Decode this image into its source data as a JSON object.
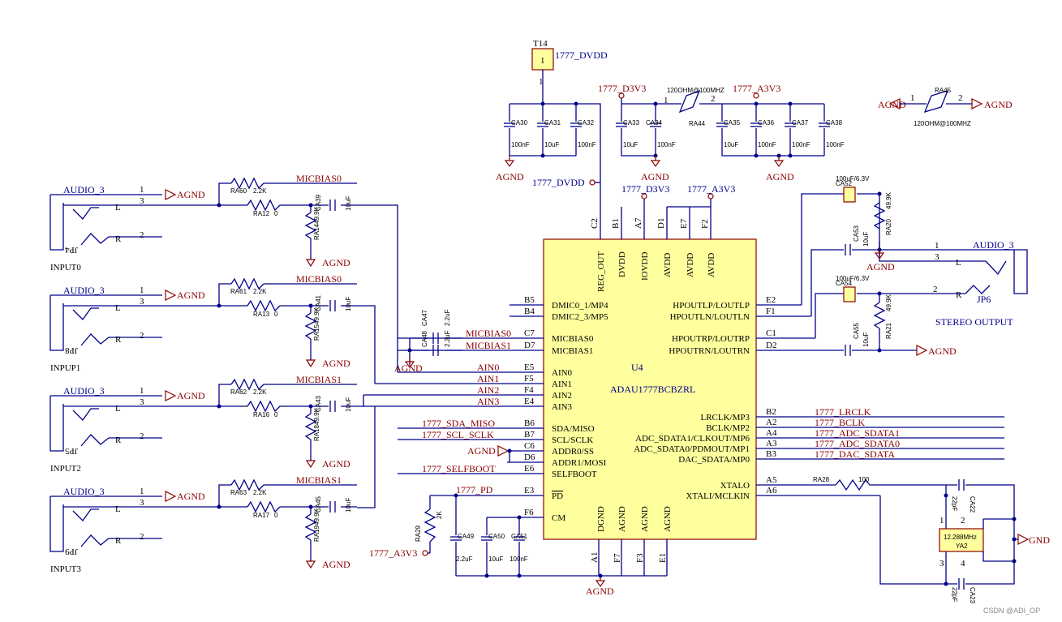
{
  "ic": {
    "ref": "U4",
    "part": "ADAU1777BCBZRL",
    "top_pins": [
      {
        "num": "C2",
        "name": "REG_OUT"
      },
      {
        "num": "B1",
        "name": "DVDD"
      },
      {
        "num": "A7",
        "name": "IOVDD"
      },
      {
        "num": "D1",
        "name": "AVDD"
      },
      {
        "num": "E7",
        "name": "AVDD"
      },
      {
        "num": "F2",
        "name": "AVDD"
      }
    ],
    "left_pins": [
      {
        "num": "B5",
        "name": "DMIC0_1/MP4"
      },
      {
        "num": "B4",
        "name": "DMIC2_3/MP5"
      },
      {
        "num": "C7",
        "name": "MICBIAS0"
      },
      {
        "num": "D7",
        "name": "MICBIAS1"
      },
      {
        "num": "E5",
        "name": "AIN0"
      },
      {
        "num": "F5",
        "name": "AIN1"
      },
      {
        "num": "F4",
        "name": "AIN2"
      },
      {
        "num": "E4",
        "name": "AIN3"
      },
      {
        "num": "B6",
        "name": "SDA/MISO"
      },
      {
        "num": "B7",
        "name": "SCL/SCLK"
      },
      {
        "num": "C6",
        "name": "ADDR0/SS"
      },
      {
        "num": "D6",
        "name": "ADDR1/MOSI"
      },
      {
        "num": "E6",
        "name": "SELFBOOT"
      },
      {
        "num": "E3",
        "name": "PD"
      },
      {
        "num": "F6",
        "name": "CM"
      }
    ],
    "right_pins": [
      {
        "num": "E2",
        "name": "HPOUTLP/LOUTLP"
      },
      {
        "num": "F1",
        "name": "HPOUTLN/LOUTLN"
      },
      {
        "num": "C1",
        "name": "HPOUTRP/LOUTRP"
      },
      {
        "num": "D2",
        "name": "HPOUTRN/LOUTRN"
      },
      {
        "num": "B2",
        "name": "LRCLK/MP3"
      },
      {
        "num": "A2",
        "name": "BCLK/MP2"
      },
      {
        "num": "A4",
        "name": "ADC_SDATA1/CLKOUT/MP6"
      },
      {
        "num": "A3",
        "name": "ADC_SDATA0/PDMOUT/MP1"
      },
      {
        "num": "B3",
        "name": "DAC_SDATA/MP0"
      },
      {
        "num": "A5",
        "name": "XTALO"
      },
      {
        "num": "A6",
        "name": "XTALI/MCLKIN"
      }
    ],
    "bottom_pins": [
      {
        "num": "A1",
        "name": "DGND"
      },
      {
        "num": "F7",
        "name": "AGND"
      },
      {
        "num": "F3",
        "name": "AGND"
      },
      {
        "num": "E1",
        "name": "AGND"
      }
    ]
  },
  "nets": {
    "agnd": "AGND",
    "gnd": "GND",
    "dvdd": "1777_DVDD",
    "d3v3": "1777_D3V3",
    "a3v3": "1777_A3V3",
    "micbias0": "MICBIAS0",
    "micbias1": "MICBIAS1",
    "ain0": "AIN0",
    "ain1": "AIN1",
    "ain2": "AIN2",
    "ain3": "AIN3",
    "sda": "1777_SDA_MISO",
    "scl": "1777_SCL_SCLK",
    "selfboot": "1777_SELFBOOT",
    "pd": "1777_PD",
    "lrclk": "1777_LRCLK",
    "bclk": "1777_BCLK",
    "adc1": "1777_ADC_SDATA1",
    "adc0": "1777_ADC_SDATA0",
    "dac": "1777_DAC_SDATA"
  },
  "inputs": [
    {
      "jack": "AUDIO_3",
      "ref": "JP4",
      "label": "INPUT0",
      "r_bias": "RA60",
      "r_series": "RA12",
      "r_load": "RA14",
      "cap": "CA39"
    },
    {
      "jack": "AUDIO_3",
      "ref": "JP8",
      "label": "INPUP1",
      "r_bias": "RA61",
      "r_series": "RA13",
      "r_load": "RA15",
      "cap": "CA41"
    },
    {
      "jack": "AUDIO_3",
      "ref": "JP5",
      "label": "INPUT2",
      "r_bias": "RA62",
      "r_series": "RA16",
      "r_load": "RA18",
      "cap": "CA43"
    },
    {
      "jack": "AUDIO_3",
      "ref": "JP9",
      "label": "INPUT3",
      "r_bias": "RA63",
      "r_series": "RA17",
      "r_load": "RA19",
      "cap": "CA45"
    }
  ],
  "jack_pins": {
    "p1": "1",
    "p2": "2",
    "p3": "3",
    "l": "L",
    "r": "R"
  },
  "values": {
    "r2k2": "2.2K",
    "r0": "0",
    "r49k9": "49.9K",
    "c10u": "10uF",
    "c100n": "100nF",
    "c2u2": "2.2uF",
    "c100u": "100uF/6.3V",
    "c22p": "22pF",
    "r100": "100",
    "r2k": "2K",
    "ferrite": "120OHM@100MHZ"
  },
  "caps_top": [
    "CA30",
    "CA31",
    "CA32",
    "CA33",
    "CA34",
    "CA35",
    "CA36",
    "CA37",
    "CA38"
  ],
  "caps_top_vals": [
    "100nF",
    "10uF",
    "100nF",
    "10uF",
    "100nF",
    "10uF",
    "100nF",
    "100nF",
    "100nF"
  ],
  "ferrite_refs": {
    "main": "RA44",
    "gnd": "RA45"
  },
  "testpoint": {
    "ref": "T14",
    "pin": "1"
  },
  "micbias_caps": {
    "c1": "CA47",
    "c2": "CA48"
  },
  "outputs": {
    "cap_l": "CA52",
    "cap_lr": "CA53",
    "cap_r": "CA54",
    "cap_rr": "CA55",
    "res_l": "RA20",
    "res_r": "RA21",
    "jack": "AUDIO_3",
    "ref": "JP6",
    "label": "STEREO OUTPUT"
  },
  "bottom_parts": {
    "res_pd": "RA29",
    "c49": "CA49",
    "c50": "CA50",
    "c51": "CA51"
  },
  "xtal": {
    "res": "RA28",
    "c1": "CA22",
    "c2": "CA23",
    "part": "12.288MHz",
    "ref": "YA2",
    "pins": [
      "1",
      "2",
      "3",
      "4"
    ]
  },
  "watermark": "CSDN @ADI_OP"
}
